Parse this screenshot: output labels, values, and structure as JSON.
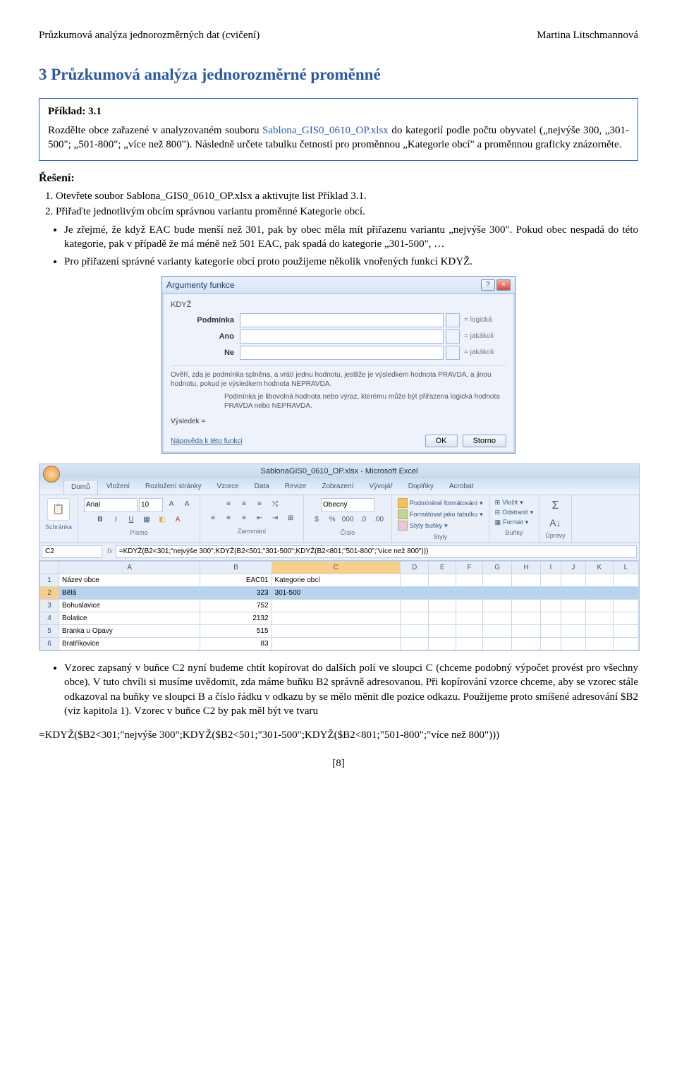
{
  "header": {
    "left": "Průzkumová analýza jednorozměrných dat (cvičení)",
    "right": "Martina Litschmannová"
  },
  "title": "3  Průzkumová analýza jednorozměrné proměnné",
  "box": {
    "label": "Příklad: 3.1",
    "text_pre": "Rozdělte obce zařazené v analyzovaném souboru ",
    "file": "Sablona_GIS0_0610_OP.xlsx",
    "text_post": " do kategorií podle počtu obyvatel („nejvýše 300, „301-500\"; „501-800\"; „více než 800\"). Následně určete tabulku četností pro proměnnou „Kategorie obcí\" a proměnnou graficky znázorněte."
  },
  "reseni_label": "Řešení:",
  "steps": [
    "Otevřete soubor Sablona_GIS0_0610_OP.xlsx a aktivujte list Příklad 3.1.",
    "Přiřaďte jednotlivým obcím správnou variantu proměnné Kategorie obcí."
  ],
  "bullets1": [
    "Je zřejmé, že když EAC bude menší než 301, pak by obec měla mít přiřazenu variantu „nejvýše 300\". Pokud obec nespadá do této kategorie, pak v případě že má méně než 501 EAC, pak spadá do kategorie „301-500\", …",
    "Pro přiřazení správné varianty kategorie obcí proto použijeme několik vnořených funkcí KDYŽ."
  ],
  "dialog": {
    "title": "Argumenty funkce",
    "fn": "KDYŽ",
    "fields": {
      "podminka": {
        "label": "Podmínka",
        "hint": "= logická"
      },
      "ano": {
        "label": "Ano",
        "hint": "= jakákoli"
      },
      "ne": {
        "label": "Ne",
        "hint": "= jakákoli"
      }
    },
    "desc": "Ověří, zda je podmínka splněna, a vrátí jednu hodnotu, jestliže je výsledkem hodnota PRAVDA, a jinou hodnotu, pokud je výsledkem hodnota NEPRAVDA.",
    "desc2": "Podmínka   je libovolná hodnota nebo výraz, kterému může být přiřazena logická hodnota PRAVDA nebo NEPRAVDA.",
    "result_label": "Výsledek =",
    "help": "Nápověda k této funkci",
    "ok": "OK",
    "cancel": "Storno"
  },
  "excel": {
    "title": "SablonaGIS0_0610_OP.xlsx - Microsoft Excel",
    "tabs": [
      "Domů",
      "Vložení",
      "Rozložení stránky",
      "Vzorce",
      "Data",
      "Revize",
      "Zobrazení",
      "Vývojář",
      "Doplňky",
      "Acrobat"
    ],
    "active_tab": 0,
    "font": {
      "name": "Arial",
      "size": "10"
    },
    "number_format": "Obecný",
    "styles_group": {
      "cond": "Podmíněné formátování",
      "table": "Formátovat jako tabulku",
      "cell": "Styly buňky"
    },
    "cells_group": {
      "insert": "Vložit",
      "delete": "Odstranit",
      "format": "Formát"
    },
    "group_labels": {
      "clipboard": "Schránka",
      "font": "Písmo",
      "align": "Zarovnání",
      "number": "Číslo",
      "styles": "Styly",
      "cells": "Buňky",
      "edit": "Úpravy"
    },
    "paste_label": "Vložit",
    "sigma_label": "Σ",
    "find_label": "Seřadit a filtrovat",
    "namebox": "C2",
    "formula": "=KDYŽ(B2<301;\"nejvýše 300\";KDYŽ(B2<501;\"301-500\";KDYŽ(B2<801;\"501-800\";\"více než 800\")))",
    "cols": [
      "A",
      "B",
      "C",
      "D",
      "E",
      "F",
      "G",
      "H",
      "I",
      "J",
      "K",
      "L"
    ],
    "rows": [
      {
        "n": "1",
        "a": "Název obce",
        "b": "EAC01",
        "c": "Kategorie obcí"
      },
      {
        "n": "2",
        "a": "Bělá",
        "b": "323",
        "c": "301-500",
        "sel": true
      },
      {
        "n": "3",
        "a": "Bohuslavice",
        "b": "752",
        "c": ""
      },
      {
        "n": "4",
        "a": "Bolatice",
        "b": "2132",
        "c": ""
      },
      {
        "n": "5",
        "a": "Branka u Opavy",
        "b": "515",
        "c": ""
      },
      {
        "n": "6",
        "a": "Bratříkovice",
        "b": "83",
        "c": ""
      }
    ]
  },
  "bullet2": "Vzorec zapsaný v buňce C2 nyní budeme chtít kopírovat do dalších polí ve sloupci C (chceme podobný výpočet provést pro všechny obce). V tuto chvíli si musíme uvědomit, zda máme buňku B2 správně adresovanou. Při kopírování vzorce chceme, aby se vzorec stále odkazoval na buňky ve sloupci B a číslo řádku v odkazu by se mělo měnit dle pozice odkazu. Použijeme proto smíšené adresování $B2 (viz kapitola 1). Vzorec v buňce C2 by pak měl být ve tvaru",
  "formula_line": "=KDYŽ($B2<301;\"nejvýše 300\";KDYŽ($B2<501;\"301-500\";KDYŽ($B2<801;\"501-800\";\"více než 800\")))",
  "pagenum": "[8]"
}
